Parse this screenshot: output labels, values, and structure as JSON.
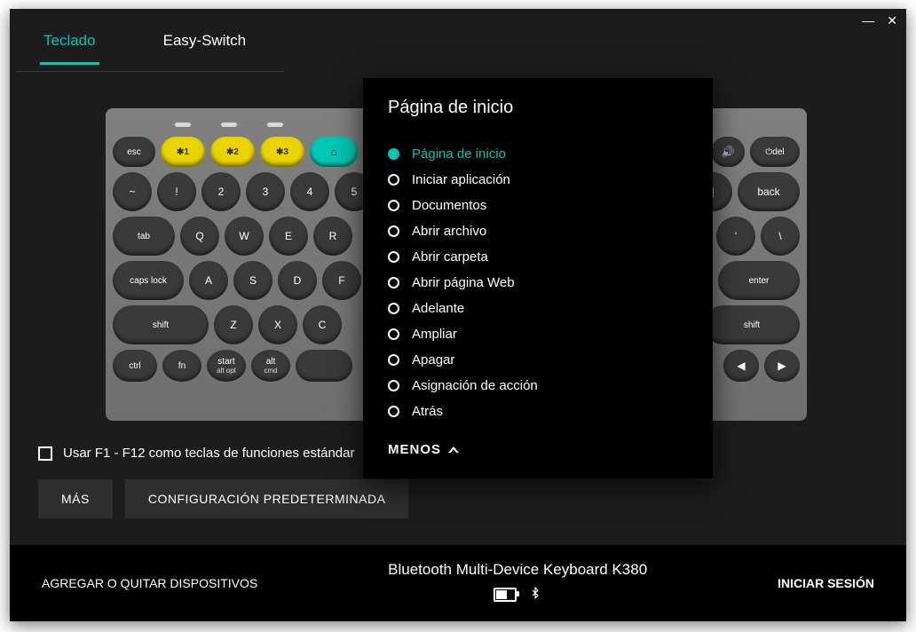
{
  "titlebar": {
    "minimize": "—",
    "close": "✕"
  },
  "tabs": {
    "keyboard": "Teclado",
    "easy_switch": "Easy-Switch"
  },
  "panel": {
    "title": "Página de inicio",
    "options": [
      "Página de inicio",
      "Iniciar aplicación",
      "Documentos",
      "Abrir archivo",
      "Abrir carpeta",
      "Abrir página Web",
      "Adelante",
      "Ampliar",
      "Apagar",
      "Asignación de acción",
      "Atrás"
    ],
    "selected_index": 0,
    "less_label": "MENOS"
  },
  "checkbox": {
    "label": "Usar F1 - F12 como teclas de funciones estándar"
  },
  "buttons": {
    "more": "MÁS",
    "default": "CONFIGURACIÓN PREDETERMINADA"
  },
  "bottombar": {
    "add_remove": "AGREGAR O QUITAR DISPOSITIVOS",
    "device_name": "Bluetooth Multi-Device Keyboard K380",
    "login": "INICIAR SESIÓN"
  },
  "keys": {
    "esc": "esc",
    "bt1": "✱1",
    "bt2": "✱2",
    "bt3": "✱3",
    "back": "back",
    "enter": "enter",
    "shift": "shift",
    "tab": "tab",
    "caps": "caps lock",
    "ctrl": "ctrl",
    "fn": "fn",
    "start": "start",
    "start_sub": "alt opt",
    "alt": "alt",
    "alt_sub": "cmd",
    "del": "del",
    "tilde": "~",
    "q": "Q",
    "w": "W",
    "e": "E",
    "r": "R",
    "a": "A",
    "s": "S",
    "d": "D",
    "f": "F",
    "z": "Z",
    "x": "X",
    "c": "C",
    "excl": "!",
    "n2": "2",
    "n3": "3",
    "n4": "4",
    "n5": "5"
  }
}
